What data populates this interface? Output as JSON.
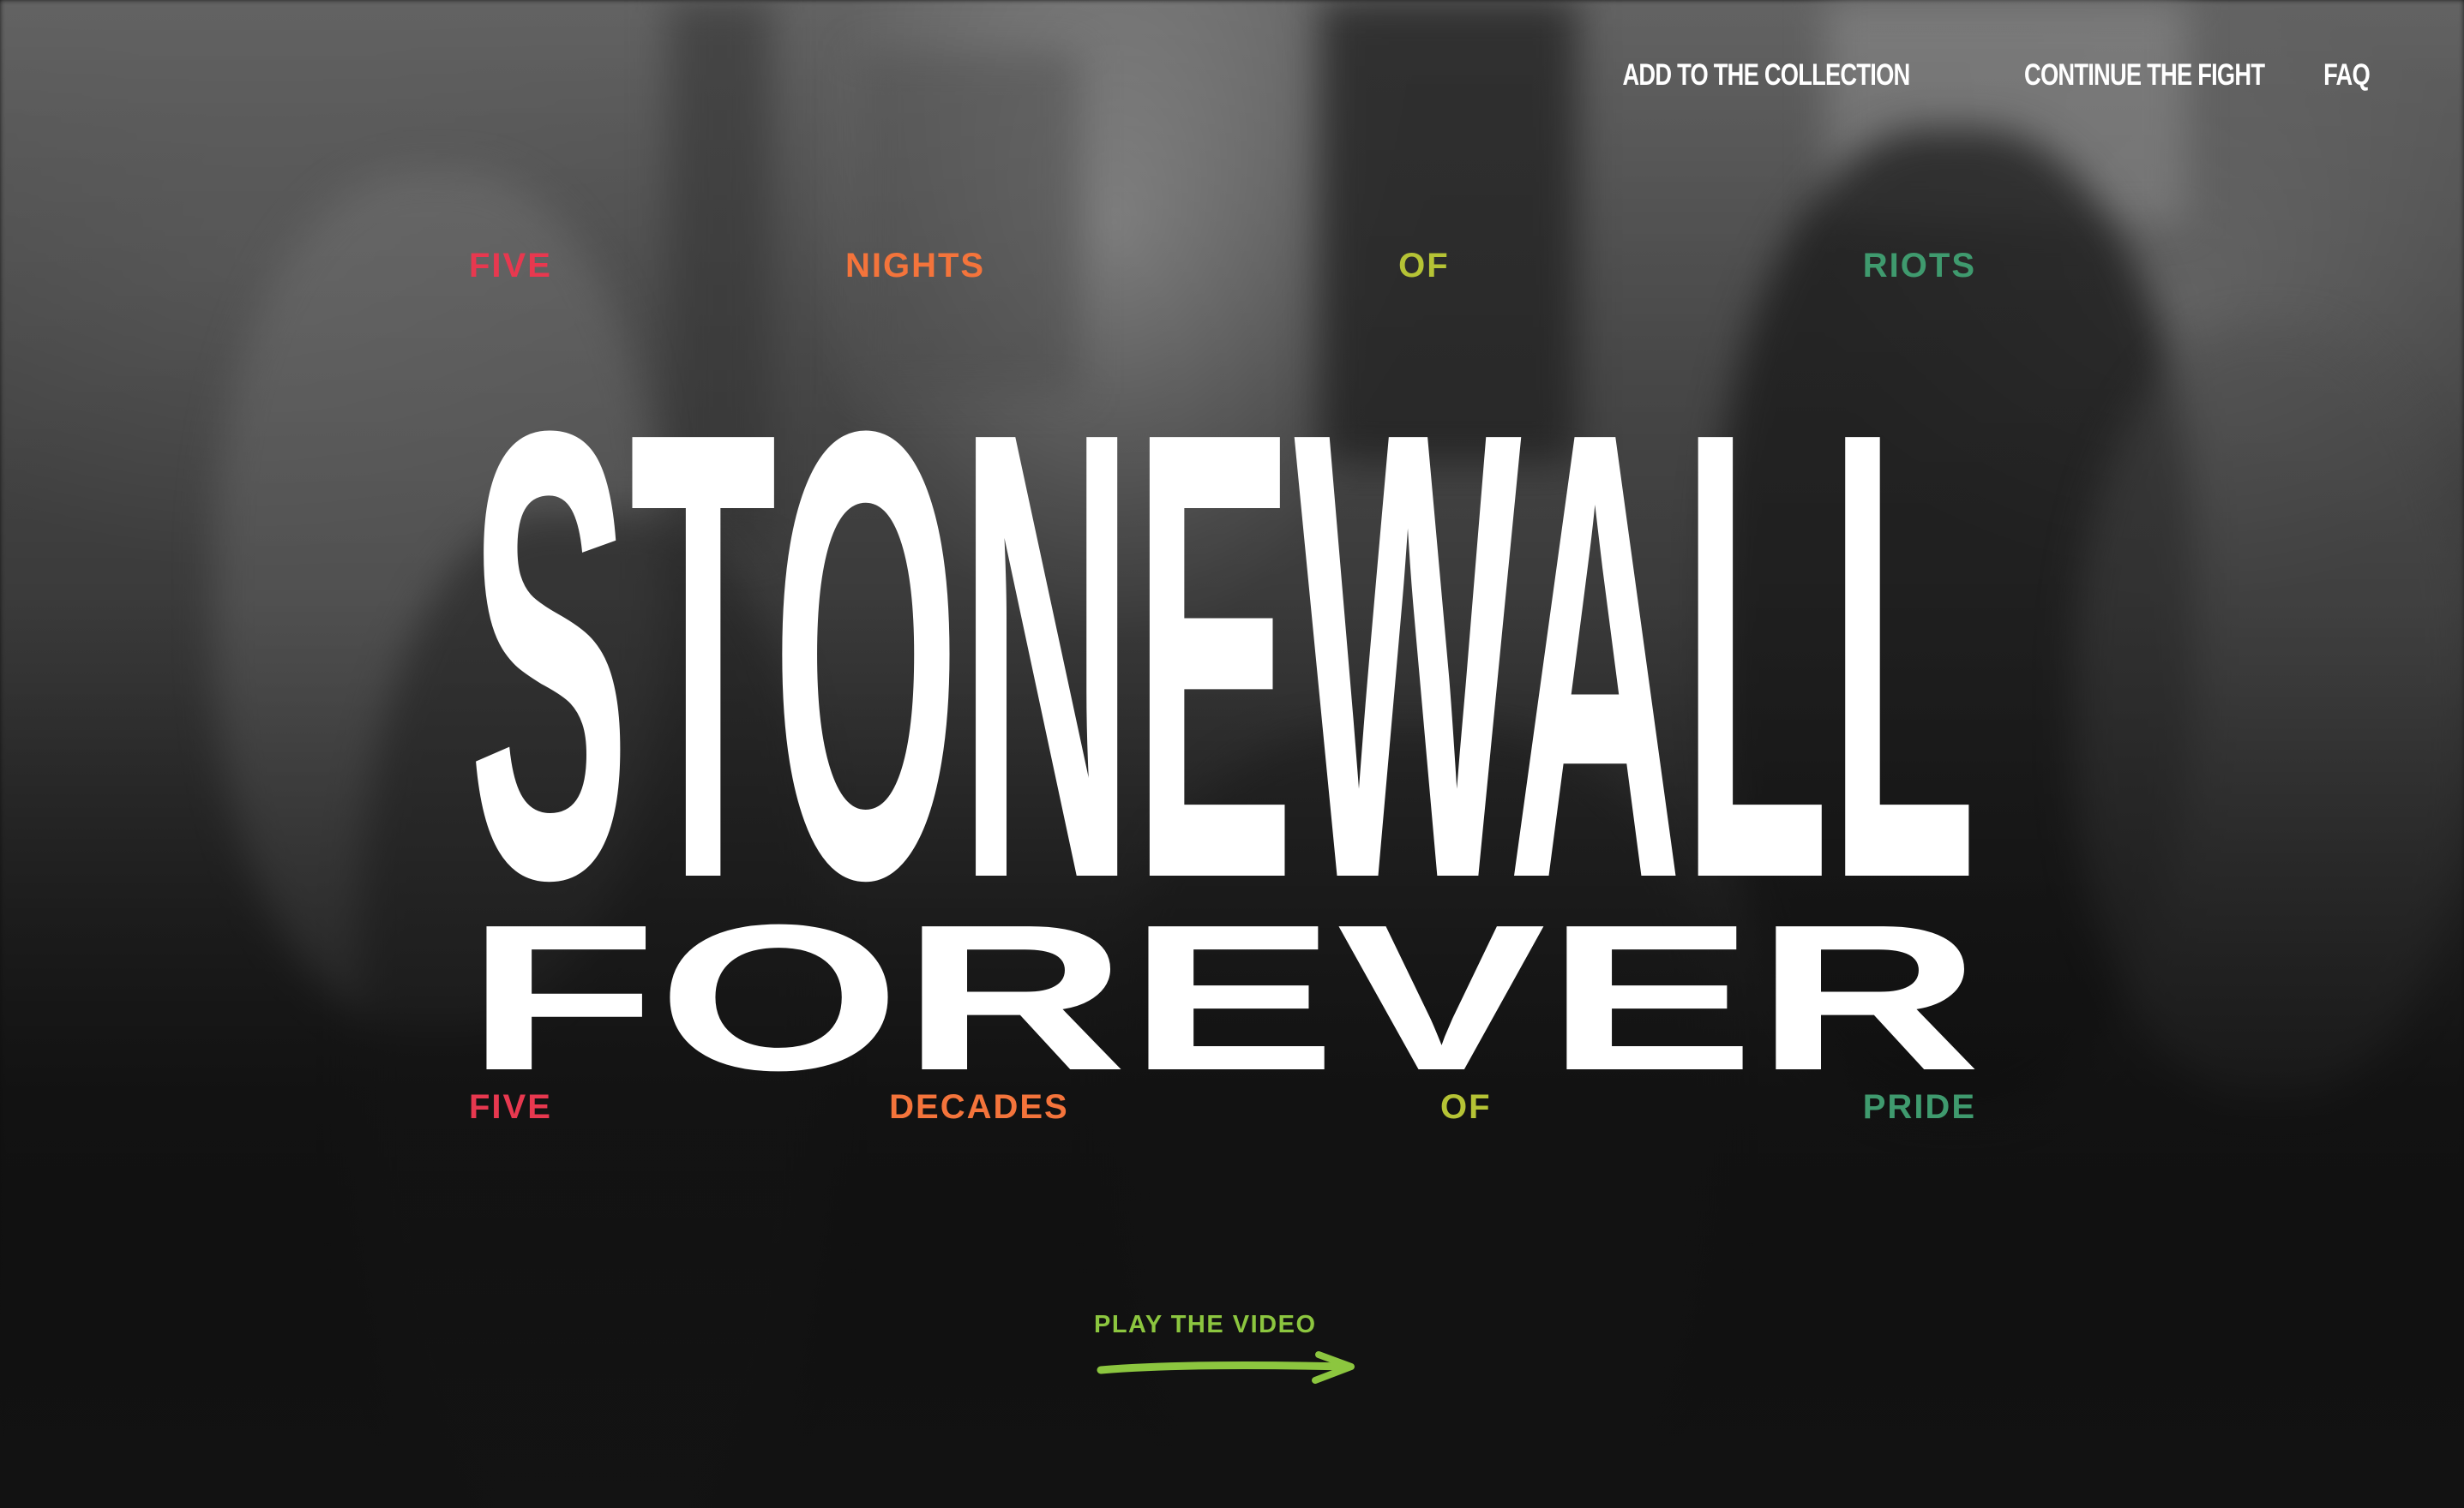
{
  "nav": {
    "items": [
      {
        "label": "ADD TO THE COLLECTION"
      },
      {
        "label": "CONTINUE THE FIGHT"
      },
      {
        "label": "FAQ"
      }
    ]
  },
  "tagline_top": {
    "words": [
      "FIVE",
      "NIGHTS",
      "OF",
      "RIOTS"
    ]
  },
  "headline": {
    "line1": "STONEWALL",
    "line2": "FOREVER"
  },
  "tagline_bottom": {
    "words": [
      "FIVE",
      "DECADES",
      "OF",
      "PRIDE"
    ]
  },
  "cta": {
    "label": "PLAY THE VIDEO",
    "icon": "hand-drawn-arrow-icon"
  },
  "colors": {
    "text": "#ffffff",
    "word_1": "#e8384f",
    "word_2": "#f4743b",
    "word_3": "#b5c335",
    "word_4": "#3f9a6e",
    "cta": "#8cc63f"
  }
}
